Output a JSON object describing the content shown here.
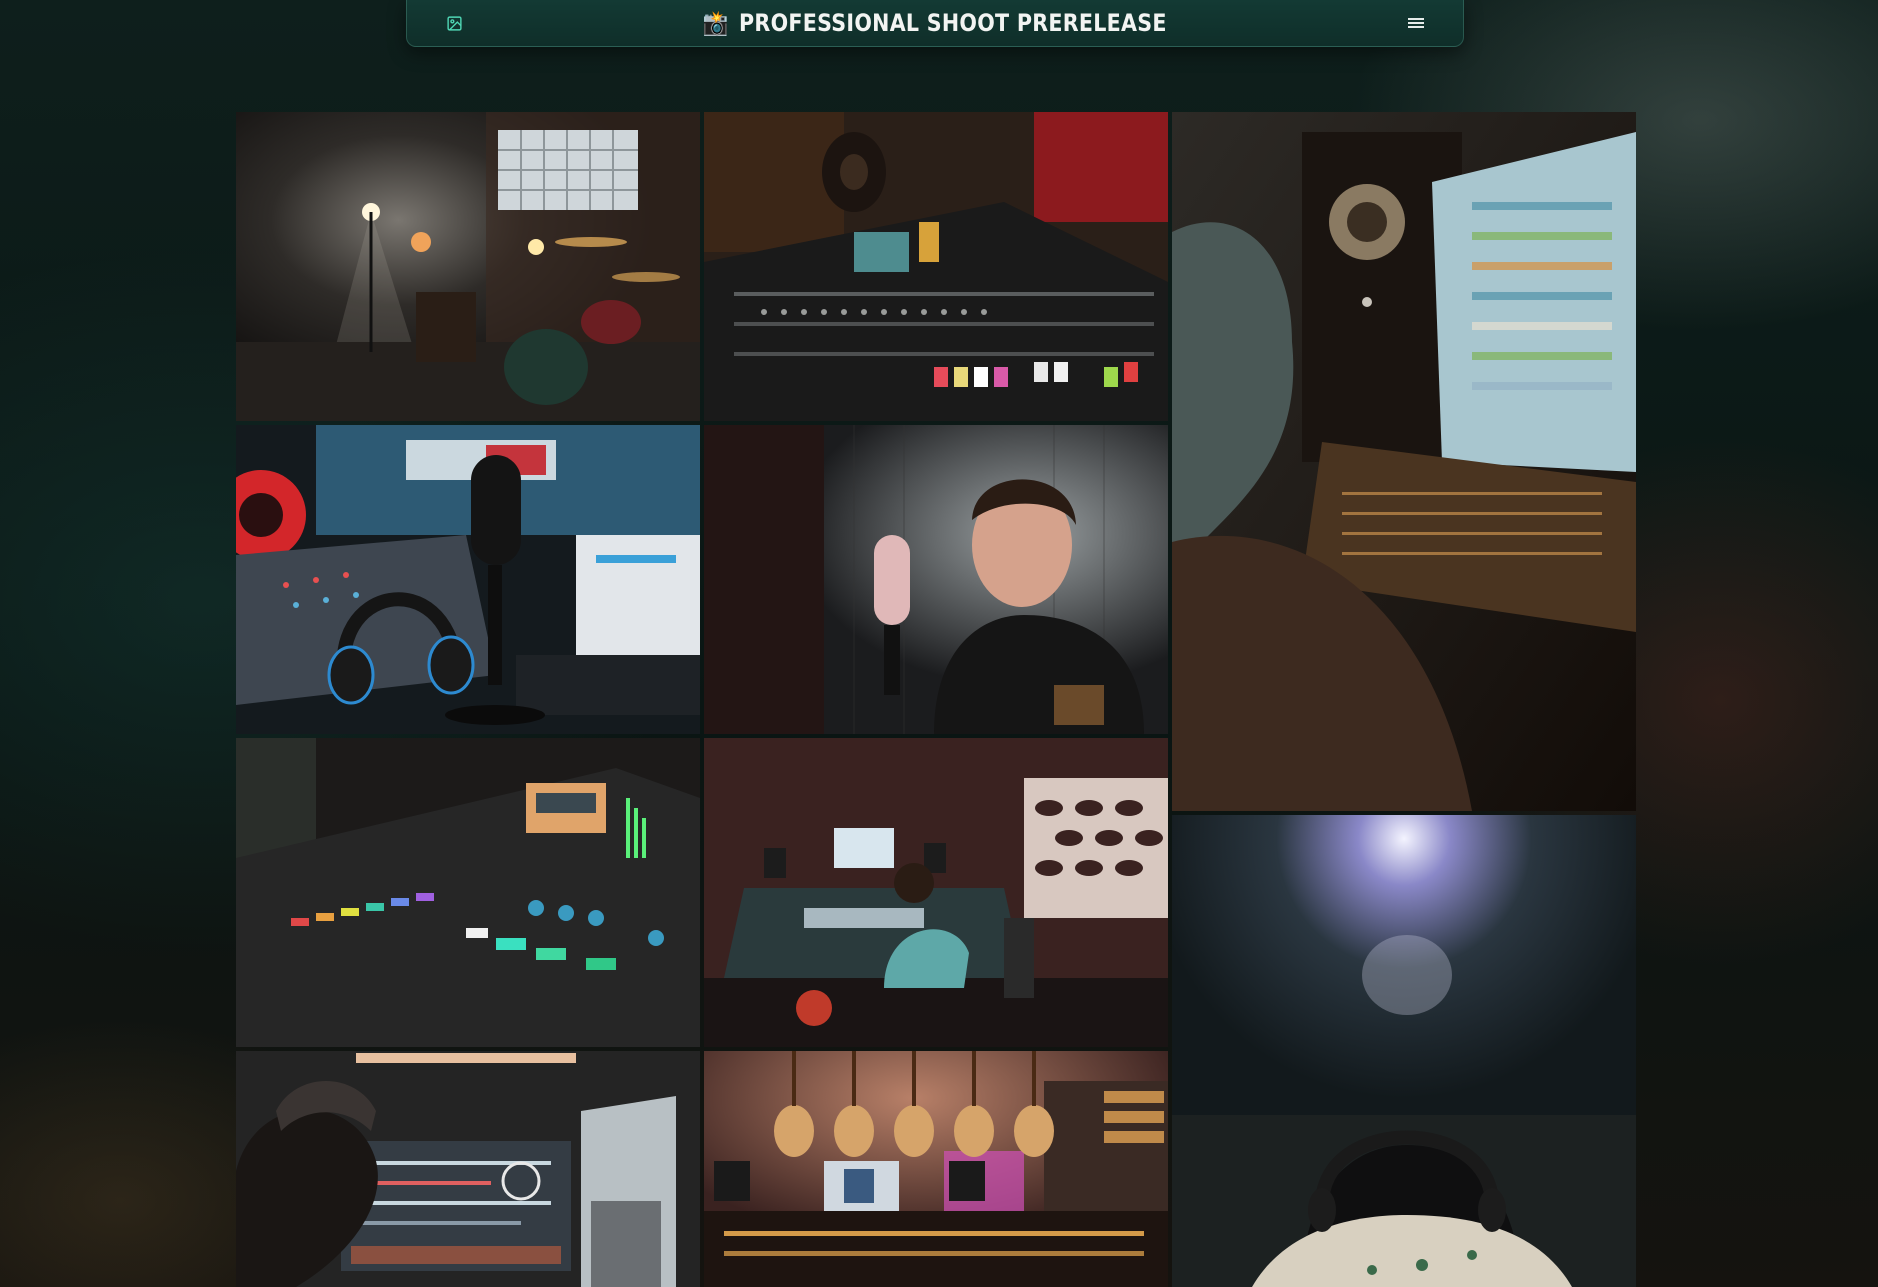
{
  "navbar": {
    "title": "PROFESSIONAL SHOOT PRERELEASE",
    "left_icon": "image-icon",
    "title_icon": "camera-icon",
    "title_glyph": "📸",
    "right_icon": "menu-icon"
  },
  "colors": {
    "navbar_bg": "#123630",
    "page_bg": "#0b1513",
    "accent": "#4fd6b4"
  },
  "gallery": {
    "images": [
      {
        "id": "drum-room",
        "icon": "image-icon"
      },
      {
        "id": "mixing-console",
        "icon": "image-icon"
      },
      {
        "id": "producer-daw-monitor",
        "icon": "image-icon"
      },
      {
        "id": "podcast-mic-headphones",
        "icon": "image-icon"
      },
      {
        "id": "vocalist-mic",
        "icon": "image-icon"
      },
      {
        "id": "digital-mixer",
        "icon": "image-icon"
      },
      {
        "id": "studio-engineer",
        "icon": "image-icon"
      },
      {
        "id": "producer-screens",
        "icon": "image-icon"
      },
      {
        "id": "guitar-wall-studio",
        "icon": "image-icon"
      },
      {
        "id": "spotlight-headphones",
        "icon": "image-icon"
      }
    ]
  }
}
